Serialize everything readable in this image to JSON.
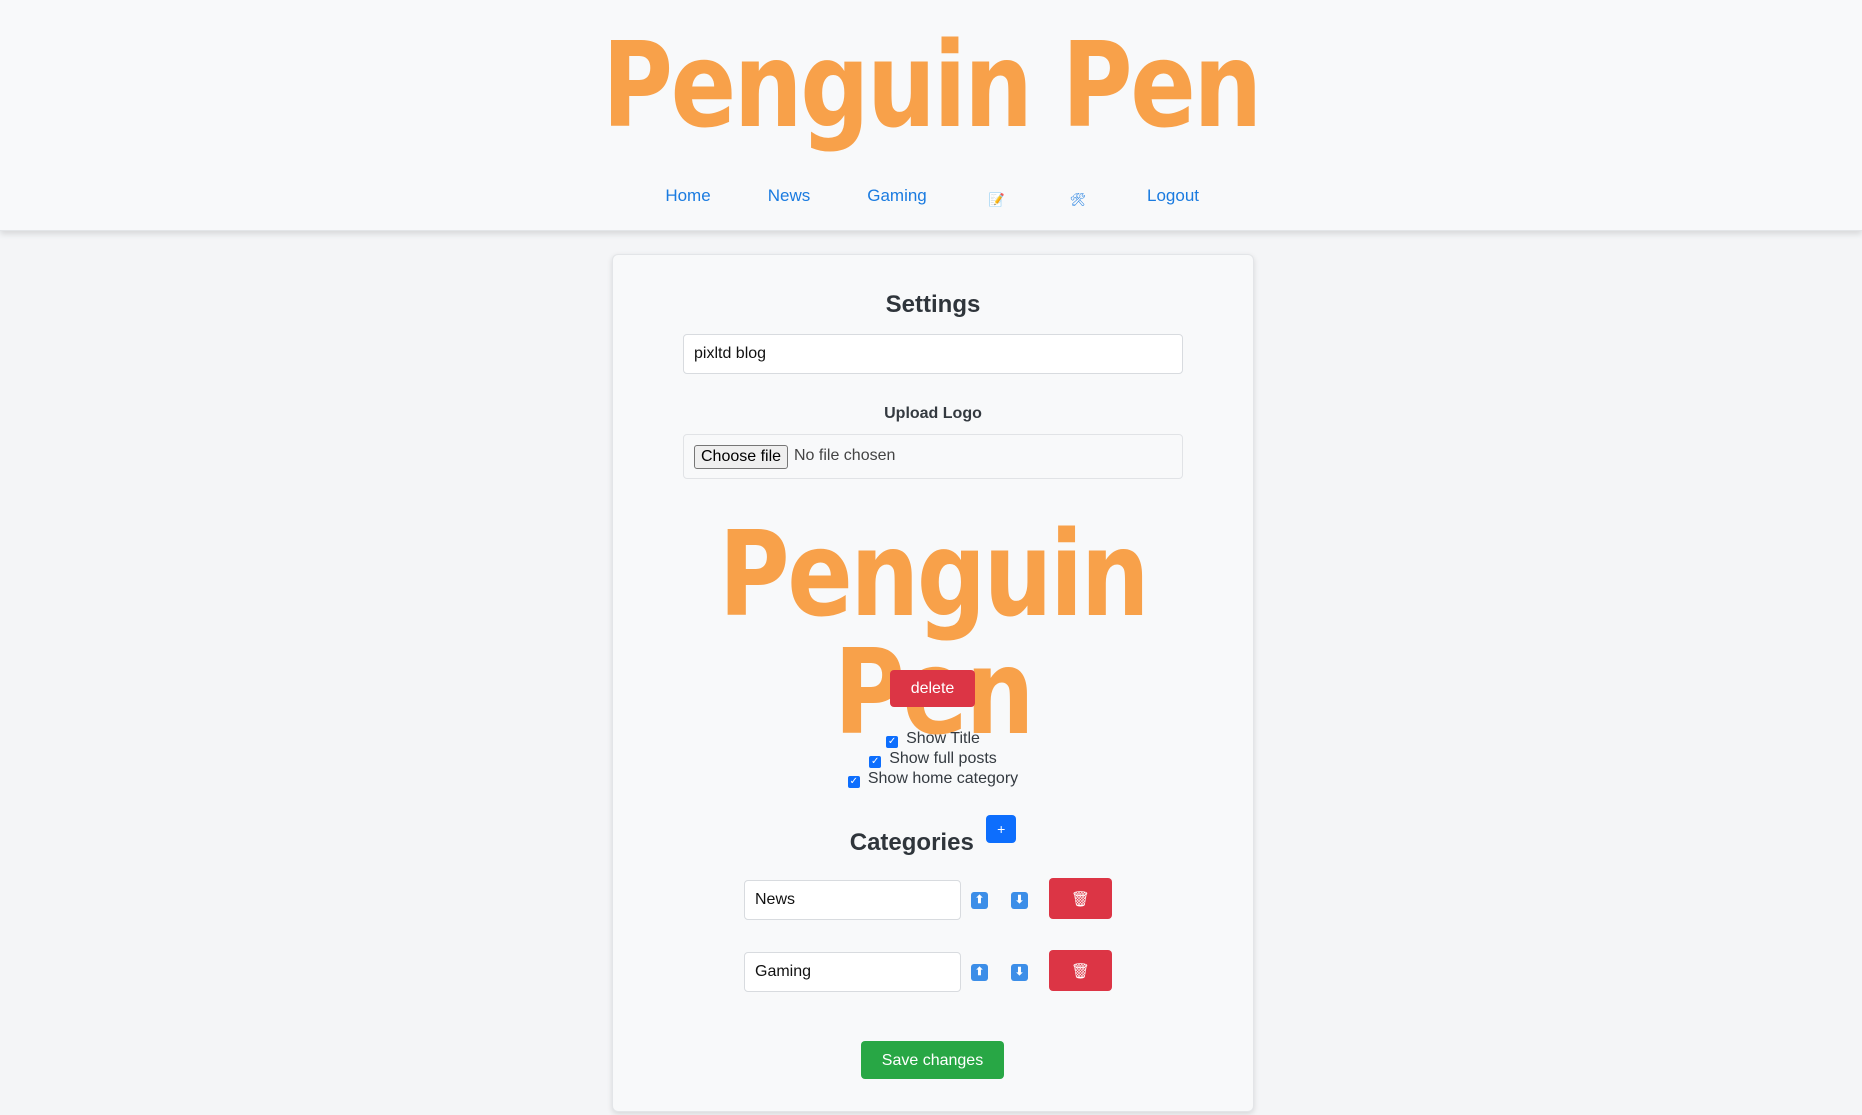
{
  "brand": {
    "logo_text": "Penguin Pen",
    "color": "#f8a14a"
  },
  "nav": {
    "home": "Home",
    "news": "News",
    "gaming": "Gaming",
    "edit_icon": "📝",
    "tools_icon": "🛠",
    "logout": "Logout"
  },
  "settings": {
    "title": "Settings",
    "blog_name_value": "pixltd blog",
    "upload_logo_label": "Upload Logo",
    "choose_file_label": "Choose file",
    "file_status": "No file chosen",
    "logo_preview_text": "Penguin Pen",
    "delete_label": "delete",
    "options": [
      {
        "label": "Show Title",
        "checked": true
      },
      {
        "label": "Show full posts",
        "checked": true
      },
      {
        "label": "Show home category",
        "checked": true
      }
    ]
  },
  "categories": {
    "title": "Categories",
    "add_label": "+",
    "items": [
      {
        "name": "News"
      },
      {
        "name": "Gaming"
      }
    ],
    "up_glyph": "⬆",
    "down_glyph": "⬇",
    "delete_glyph": "🗑"
  },
  "save_label": "Save changes",
  "colors": {
    "link": "#1a7be0",
    "danger": "#dc3545",
    "success": "#28a745",
    "primary": "#0d6efd"
  }
}
